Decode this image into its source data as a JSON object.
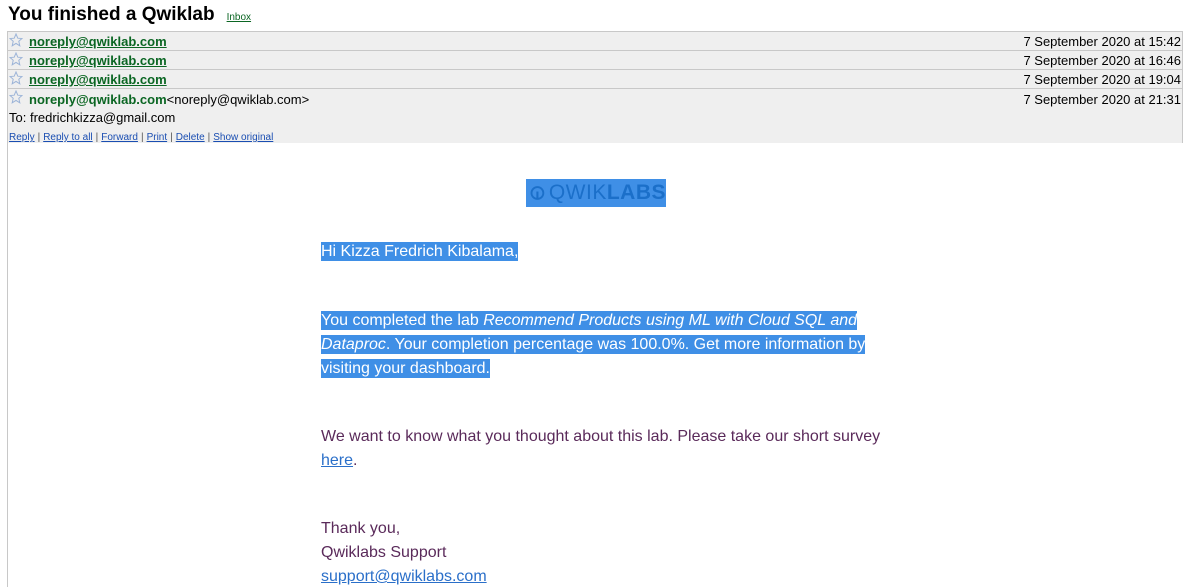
{
  "subject": "You finished a Qwiklab",
  "inbox_label": "Inbox",
  "messages": [
    {
      "sender": "noreply@qwiklab.com",
      "date": "7 September 2020 at 15:42"
    },
    {
      "sender": "noreply@qwiklab.com",
      "date": "7 September 2020 at 16:46"
    },
    {
      "sender": "noreply@qwiklab.com",
      "date": "7 September 2020 at 19:04"
    }
  ],
  "open_message": {
    "sender_name": "noreply@qwiklab.com",
    "sender_address": "<noreply@qwiklab.com>",
    "date": "7 September 2020 at 21:31",
    "to": "To: fredrichkizza@gmail.com",
    "actions": [
      "Reply",
      "Reply to all",
      "Forward",
      "Print",
      "Delete",
      "Show original"
    ]
  },
  "email_body": {
    "logo_text_light": "QWIK",
    "logo_text_bold": "LABS",
    "greeting": "Hi Kizza Fredrich Kibalama,",
    "completion_prefix": "You completed the lab ",
    "lab_name": "Recommend Products using ML with Cloud SQL and Dataproc",
    "completion_suffix": ". Your completion percentage was 100.0%. Get more information by visiting your dashboard.",
    "survey_text": "We want to know what you thought about this lab. Please take our short survey ",
    "survey_link": "here",
    "survey_end": ".",
    "thanks": "Thank you,",
    "signature": "Qwiklabs Support",
    "support_email": "support@qwiklabs.com"
  },
  "colors": {
    "sender_green": "#0b6623",
    "header_gray": "#efefef",
    "highlight_blue": "#3f8fe6",
    "body_text_purple": "#5a2a5a"
  },
  "icons": [
    "star-icon",
    "qwiklabs-logo-icon"
  ]
}
